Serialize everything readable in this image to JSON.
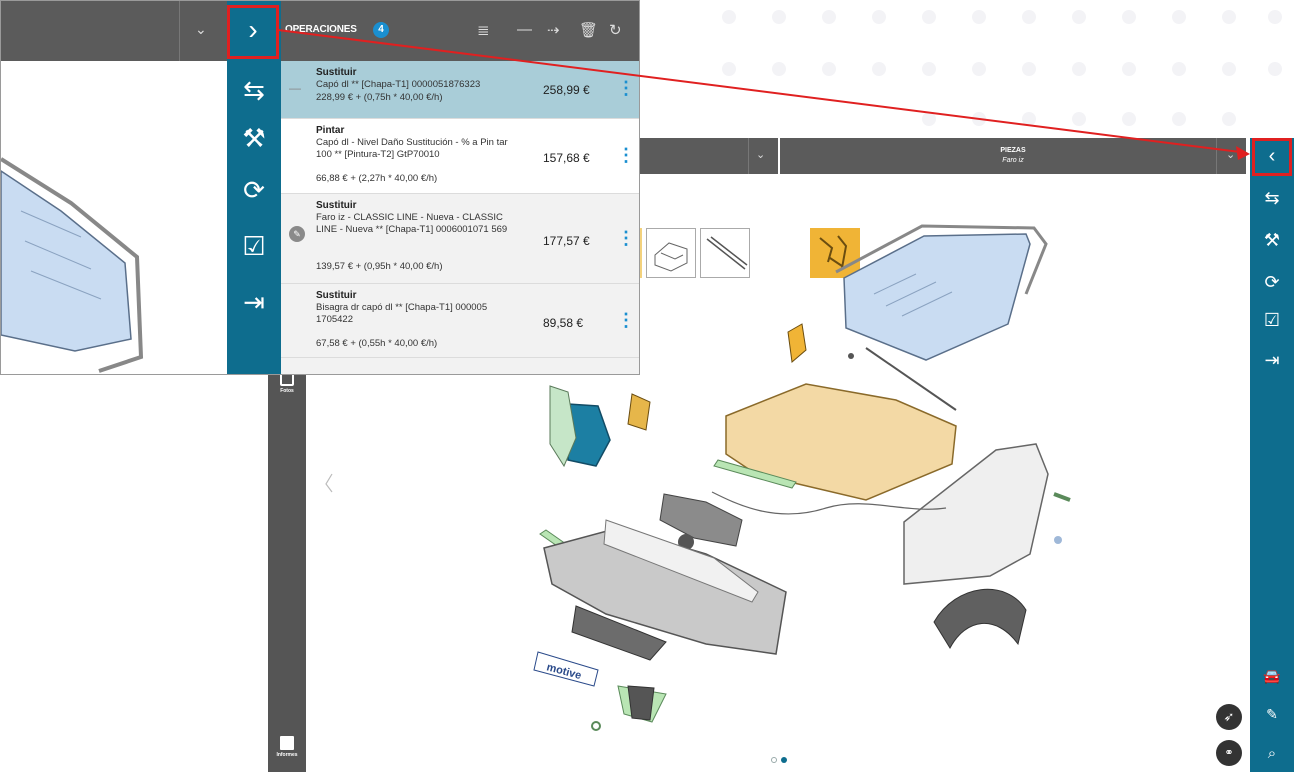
{
  "main": {
    "parts_panel_title": "PIEZAS",
    "parts_panel_subtitle": "Faro iz",
    "left_bar": [
      {
        "label": "Fotos",
        "icon": "camera-icon"
      },
      {
        "label": "Informes",
        "icon": "report-download-icon"
      }
    ],
    "right_rail_icons": [
      "collapse-panel-icon",
      "swap-icon",
      "hammer-icon",
      "replace-icon",
      "checklist-icon",
      "compress-icon",
      "car-check-icon",
      "no-paint-icon",
      "search-icon"
    ],
    "pager": {
      "count": 2,
      "active_index": 1
    },
    "brand_label": "motive"
  },
  "inset": {
    "operations_title": "OPERACIONES",
    "operations_count": "4",
    "header_icons": [
      "filter-search-icon",
      "minus-icon",
      "move-icon",
      "trash-icon",
      "undo-icon"
    ],
    "operations": [
      {
        "type": "Sustituir",
        "description": "Capó dl ** [Chapa-T1] 0000051876323",
        "cost": "228,99 € + (0,75h * 40,00 €/h)",
        "price": "258,99 €",
        "selected": true,
        "marker": "—"
      },
      {
        "type": "Pintar",
        "description": "Capó dl - Nivel Daño Sustitución - % a Pin tar 100 ** [Pintura-T2] GtP70010",
        "cost": "66,88 € + (2,27h * 40,00 €/h)",
        "price": "157,68 €",
        "selected": false,
        "marker": ""
      },
      {
        "type": "Sustituir",
        "description": "Faro iz - CLASSIC LINE - Nueva - CLASSIC LINE - Nueva ** [Chapa-T1] 0006001071 569",
        "cost": "139,57 € + (0,95h * 40,00 €/h)",
        "price": "177,57 €",
        "selected": false,
        "marker": "✎"
      },
      {
        "type": "Sustituir",
        "description": "Bisagra dr capó dl ** [Chapa-T1] 000005 1705422",
        "cost": "67,58 € + (0,55h * 40,00 €/h)",
        "price": "89,58 €",
        "selected": false,
        "marker": ""
      }
    ],
    "rail_icons": [
      "swap-icon",
      "hammer-icon",
      "replace-icon",
      "checklist-icon",
      "compress-icon"
    ]
  },
  "colors": {
    "teal": "#0e6d8e",
    "dark_gray": "#5b5b5b",
    "highlight_red": "#e02020",
    "selected_row": "#a9cdd8",
    "badge_blue": "#1a8fd0",
    "part_yellow": "#f3d27d"
  }
}
